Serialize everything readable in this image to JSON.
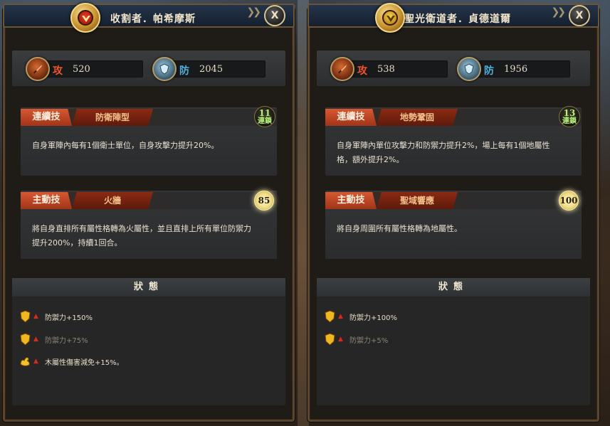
{
  "panels": [
    {
      "title": "收割者．帕希摩斯",
      "close_label": "X",
      "emblem_color": "red",
      "attack": {
        "label": "攻",
        "value": "520"
      },
      "defense": {
        "label": "防",
        "value": "2045"
      },
      "combo_skill": {
        "tag": "連續技",
        "name": "防衛陣型",
        "badge_num": "11",
        "badge_sub": "連鎖",
        "description": "自身軍陣內每有1個衛士單位，自身攻擊力提升20%。"
      },
      "active_skill": {
        "tag": "主動技",
        "name": "火牆",
        "badge_num": "85",
        "description": "將自身直排所有屬性格轉為火屬性，並且直排上所有單位防禦力提升200%，持續1回合。"
      },
      "status": {
        "title": "狀態",
        "rows": [
          {
            "text": "防禦力+150%",
            "icon": "shield-icon",
            "dim": false
          },
          {
            "text": "防禦力+75%",
            "icon": "shield-icon",
            "dim": true
          },
          {
            "text": "木屬性傷害減免+15%。",
            "icon": "muscle-icon",
            "dim": false
          }
        ]
      }
    },
    {
      "title": "聖光衛道者．貞德道爾",
      "close_label": "X",
      "emblem_color": "gold",
      "attack": {
        "label": "攻",
        "value": "538"
      },
      "defense": {
        "label": "防",
        "value": "1956"
      },
      "combo_skill": {
        "tag": "連續技",
        "name": "地勢鞏固",
        "badge_num": "13",
        "badge_sub": "連鎖",
        "description": "自身軍陣內單位攻擊力和防禦力提升2%，場上每有1個地屬性格，額外提升2%。"
      },
      "active_skill": {
        "tag": "主動技",
        "name": "聖域響應",
        "badge_num": "100",
        "description": "將自身周圍所有屬性格轉為地屬性。"
      },
      "status": {
        "title": "狀態",
        "rows": [
          {
            "text": "防禦力+100%",
            "icon": "shield-icon",
            "dim": false
          },
          {
            "text": "防禦力+5%",
            "icon": "shield-icon",
            "dim": true
          }
        ]
      }
    }
  ],
  "colors": {
    "attack": "#f0542a",
    "defense": "#4fb0dc",
    "skill_tag": "#d55832",
    "panel_bg": "#1f1b17",
    "border": "#5a4630"
  }
}
